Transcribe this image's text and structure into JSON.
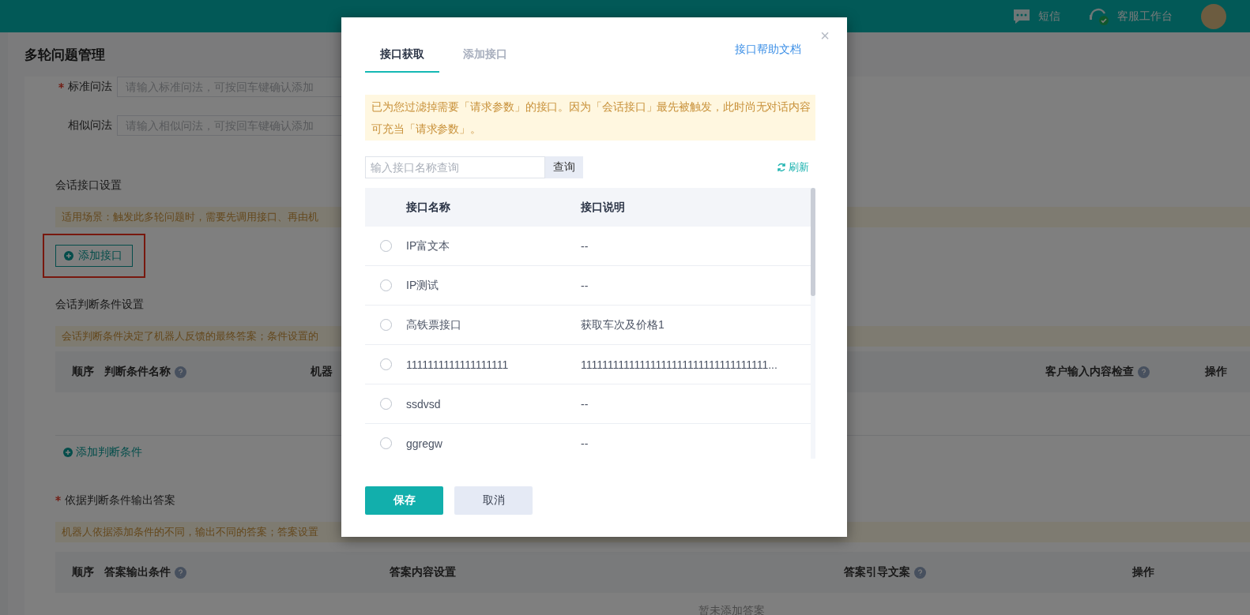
{
  "header": {
    "sms": "短信",
    "workbench": "客服工作台"
  },
  "page": {
    "title": "多轮问题管理",
    "fields": [
      {
        "label": "标准问法",
        "required": true,
        "placeholder": "请输入标准问法，可按回车键确认添加"
      },
      {
        "label": "相似问法",
        "required": false,
        "placeholder": "请输入相似问法，可按回车键确认添加"
      }
    ],
    "interface_section": {
      "title": "会话接口设置",
      "notice": "适用场景：触发此多轮问题时，需要先调用接口、再由机",
      "add_button": "添加接口"
    },
    "condition_section": {
      "title": "会话判断条件设置",
      "notice": "会话判断条件决定了机器人反馈的最终答案；条件设置的",
      "columns": [
        {
          "label": "顺序",
          "help": false
        },
        {
          "label": "判断条件名称",
          "help": true
        },
        {
          "label": "机器",
          "help": false
        },
        {
          "label": "客户输入内容检查",
          "help": true
        },
        {
          "label": "操作",
          "help": false
        }
      ],
      "add_link": "添加判断条件"
    },
    "answer_section": {
      "title": "依据判断条件输出答案",
      "required": true,
      "notice": "机器人依据添加条件的不同，输出不同的答案；答案设置",
      "columns": [
        {
          "label": "顺序",
          "help": false
        },
        {
          "label": "答案输出条件",
          "help": true
        },
        {
          "label": "答案内容设置",
          "help": false
        },
        {
          "label": "答案引导文案",
          "help": true
        },
        {
          "label": "操作",
          "help": false
        }
      ],
      "empty": "暂未添加答案"
    }
  },
  "dialog": {
    "tabs": [
      {
        "label": "接口获取",
        "selected": true
      },
      {
        "label": "添加接口",
        "selected": false
      }
    ],
    "help_link": "接口帮助文档",
    "close": "×",
    "notice": "已为您过滤掉需要「请求参数」的接口。因为「会话接口」最先被触发，此时尚无对话内容可充当「请求参数」。",
    "search": {
      "placeholder": "输入接口名称查询",
      "button": "查询"
    },
    "refresh": "刷新",
    "table": {
      "columns": [
        "接口名称",
        "接口说明"
      ],
      "rows": [
        {
          "name": "IP富文本",
          "description": "--",
          "selected": false
        },
        {
          "name": "IP测试",
          "description": "--",
          "selected": false
        },
        {
          "name": "高铁票接口",
          "description": "获取车次及价格1",
          "selected": false
        },
        {
          "name": "1111111111111111111",
          "description": "11111111111111111111111111111111111...",
          "selected": false
        },
        {
          "name": "ssdvsd",
          "description": "--",
          "selected": false
        },
        {
          "name": "ggregw",
          "description": "--",
          "selected": false
        }
      ]
    },
    "buttons": [
      {
        "label": "保存",
        "kind": "primary"
      },
      {
        "label": "取消",
        "kind": "secondary"
      }
    ]
  }
}
